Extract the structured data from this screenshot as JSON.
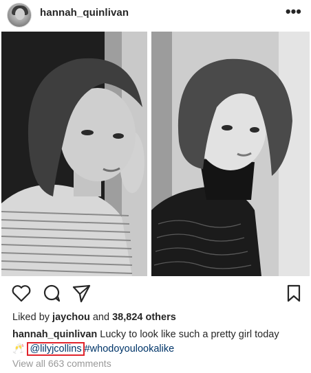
{
  "header": {
    "username": "hannah_quinlivan",
    "more_icon": "more-dots-icon",
    "more_label": "•••"
  },
  "post": {
    "photos": [
      {
        "name": "left-photo",
        "tone": "black-and-white"
      },
      {
        "name": "right-photo",
        "tone": "black-and-white"
      }
    ]
  },
  "actions": {
    "icons": [
      "heart-icon",
      "comment-icon",
      "share-icon",
      "bookmark-icon"
    ]
  },
  "likes": {
    "prefix": "Liked by ",
    "user": "jaychou",
    "middle": " and ",
    "count": "38,824 others"
  },
  "caption": {
    "user": "hannah_quinlivan",
    "text": " Lucky to look like such a pretty girl today",
    "emoji": "🥂",
    "mention": "@lilyjcollins",
    "hashtag": "#whodoyoulookalike"
  },
  "comments": {
    "label": "View all 663 comments"
  },
  "colors": {
    "link": "#003569",
    "highlight_box": "#e0232b",
    "muted": "#999999"
  }
}
